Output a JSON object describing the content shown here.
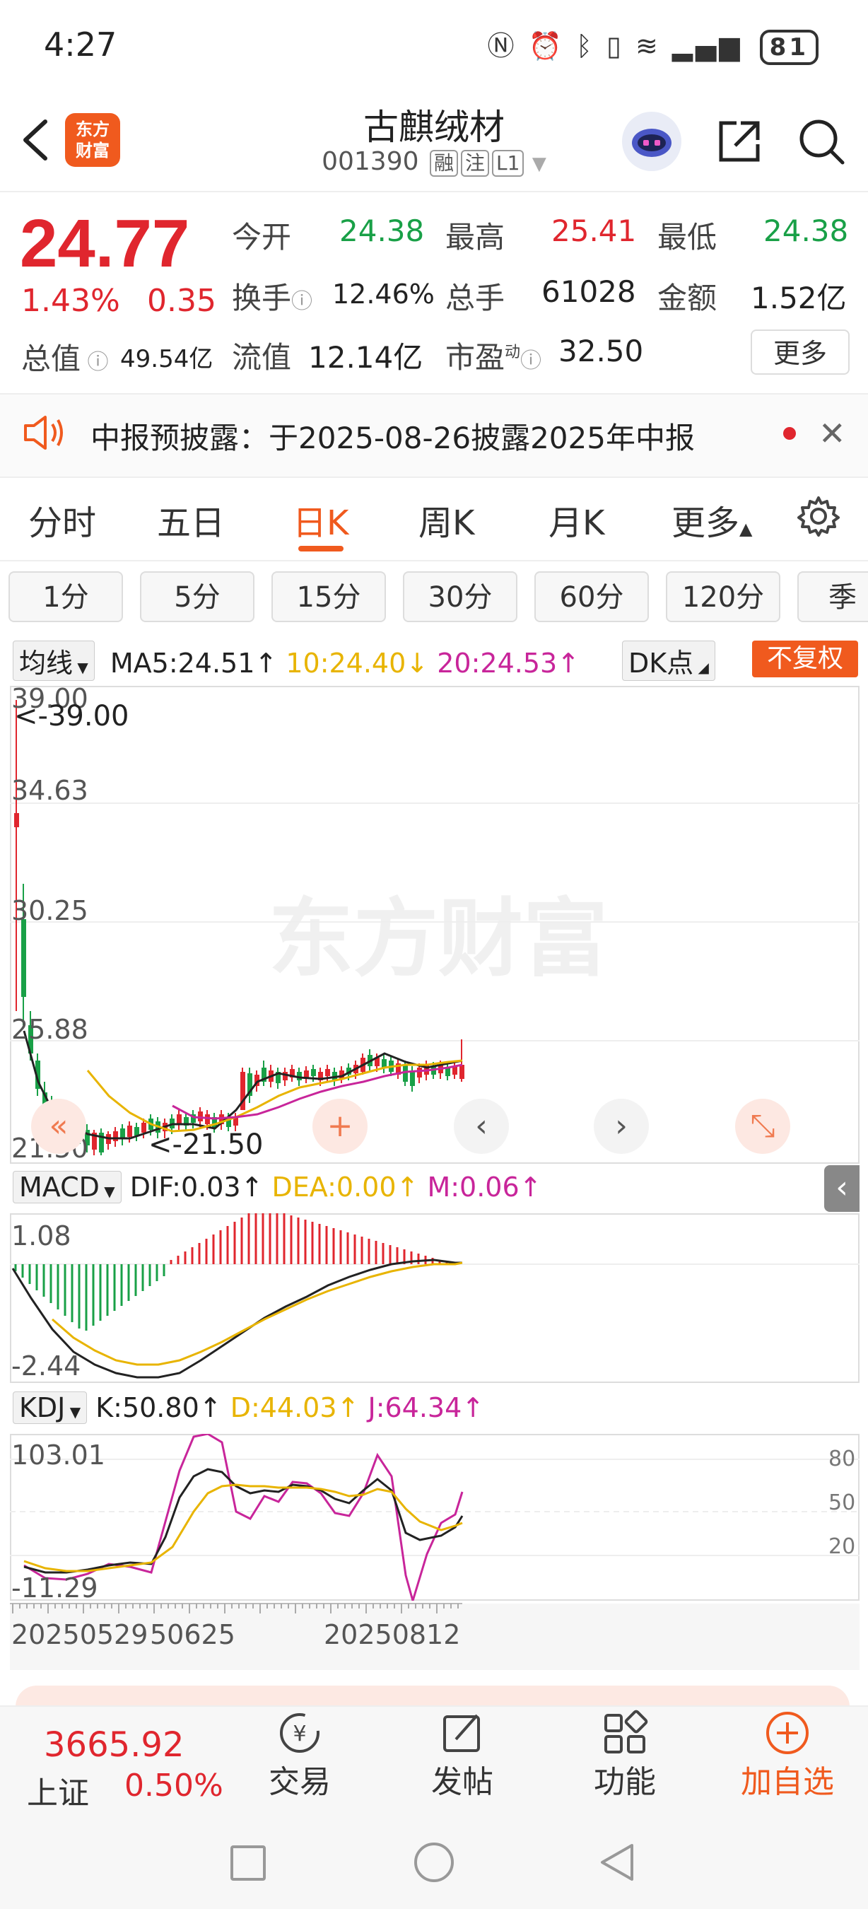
{
  "status_bar": {
    "time": "4:27",
    "battery": "81"
  },
  "header": {
    "logo_text_line1": "东方",
    "logo_text_line2": "财富",
    "stock_name": "古麒绒材",
    "stock_code": "001390",
    "tags": [
      "融",
      "注",
      "L1"
    ]
  },
  "quote": {
    "price": "24.77",
    "change_pct": "1.43%",
    "change_amt": "0.35",
    "market_cap_label": "总值",
    "market_cap_value": "49.54亿",
    "more_label": "更多",
    "fields": [
      {
        "label": "今开",
        "value": "24.38",
        "color": "#19a047"
      },
      {
        "label": "最高",
        "value": "25.41",
        "color": "#e0262e"
      },
      {
        "label": "最低",
        "value": "24.38",
        "color": "#19a047"
      },
      {
        "label": "换手",
        "value": "12.46%",
        "color": "#222222"
      },
      {
        "label": "总手",
        "value": "61028",
        "color": "#222222"
      },
      {
        "label": "金额",
        "value": "1.52亿",
        "color": "#222222"
      },
      {
        "label": "流值",
        "value": "12.14亿",
        "color": "#222222"
      },
      {
        "label": "市盈",
        "value": "32.50",
        "color": "#222222",
        "superscript": "动"
      }
    ]
  },
  "notice": {
    "text": "中报预披露：于2025-08-26披露2025年中报"
  },
  "period_tabs": [
    "分时",
    "五日",
    "日K",
    "周K",
    "月K",
    "更多"
  ],
  "active_period": "日K",
  "interval_buttons": [
    "1分",
    "5分",
    "15分",
    "30分",
    "60分",
    "120分",
    "季K"
  ],
  "ma_row": {
    "select": "均线",
    "ma5": "MA5:24.51↑",
    "ma10": "10:24.40↓",
    "ma20": "20:24.53↑",
    "dk": "DK点",
    "rights": "不复权"
  },
  "kline": {
    "y_labels": [
      "39.00",
      "34.63",
      "30.25",
      "25.88",
      "21.50"
    ],
    "max_marker": "<-39.00",
    "min_marker": "<-21.50",
    "watermark": "东方财富"
  },
  "macd_row": {
    "select": "MACD",
    "dif": "DIF:0.03↑",
    "dea": "DEA:0.00↑",
    "m": "M:0.06↑",
    "y_top": "1.08",
    "y_bottom": "-2.44"
  },
  "kdj_row": {
    "select": "KDJ",
    "k": "K:50.80↑",
    "d": "D:44.03↑",
    "j": "J:64.34↑",
    "y_top": "103.01",
    "y_bottom": "-11.29",
    "right_levels": [
      "80",
      "50",
      "20"
    ]
  },
  "x_axis": {
    "start": "20250529",
    "mid": "50625",
    "end": "20250812"
  },
  "bottom_bar": {
    "index_value": "3665.92",
    "index_name": "上证",
    "index_pct": "0.50%",
    "items": [
      "交易",
      "发帖",
      "功能",
      "加自选"
    ]
  },
  "colors": {
    "up": "#e0262e",
    "down": "#19a047",
    "accent": "#f05a1e"
  }
}
